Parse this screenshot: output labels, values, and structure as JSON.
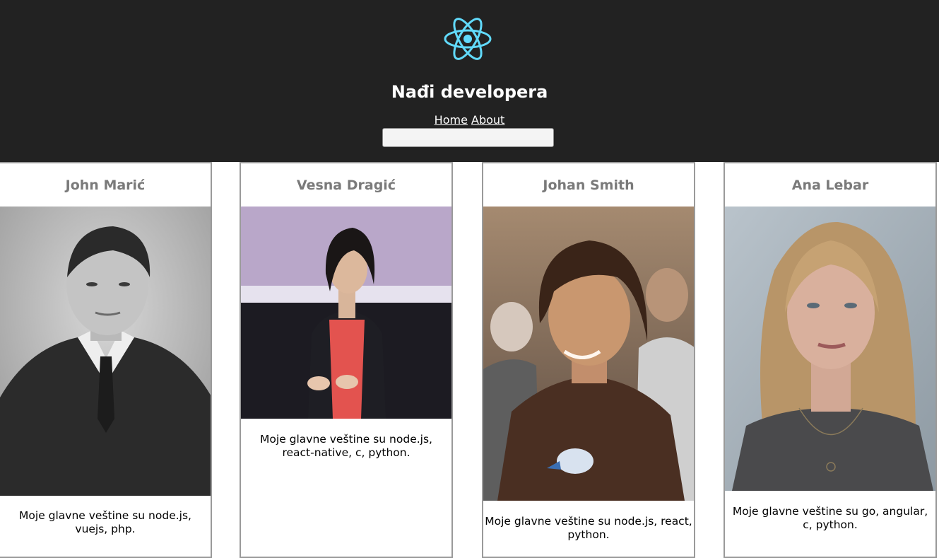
{
  "header": {
    "logo_icon": "react-atom-icon",
    "logo_color": "#61dafb",
    "title": "Nađi developera",
    "nav": {
      "home_label": "Home",
      "about_label": "About"
    },
    "search": {
      "value": "",
      "placeholder": ""
    }
  },
  "developers": [
    {
      "name": "John Marić",
      "photo_alt": "John Marić",
      "description": "Moje glavne veštine su node.js, vuejs, php."
    },
    {
      "name": "Vesna Dragić",
      "photo_alt": "Vesna Dragić",
      "description": "Moje glavne veštine su node.js, react-native, c, python."
    },
    {
      "name": "Johan Smith",
      "photo_alt": "Johan Smith",
      "description": "Moje glavne veštine su node.js, react, python."
    },
    {
      "name": "Ana Lebar",
      "photo_alt": "Ana Lebar",
      "description": "Moje glavne veštine su go, angular, c, python."
    }
  ]
}
